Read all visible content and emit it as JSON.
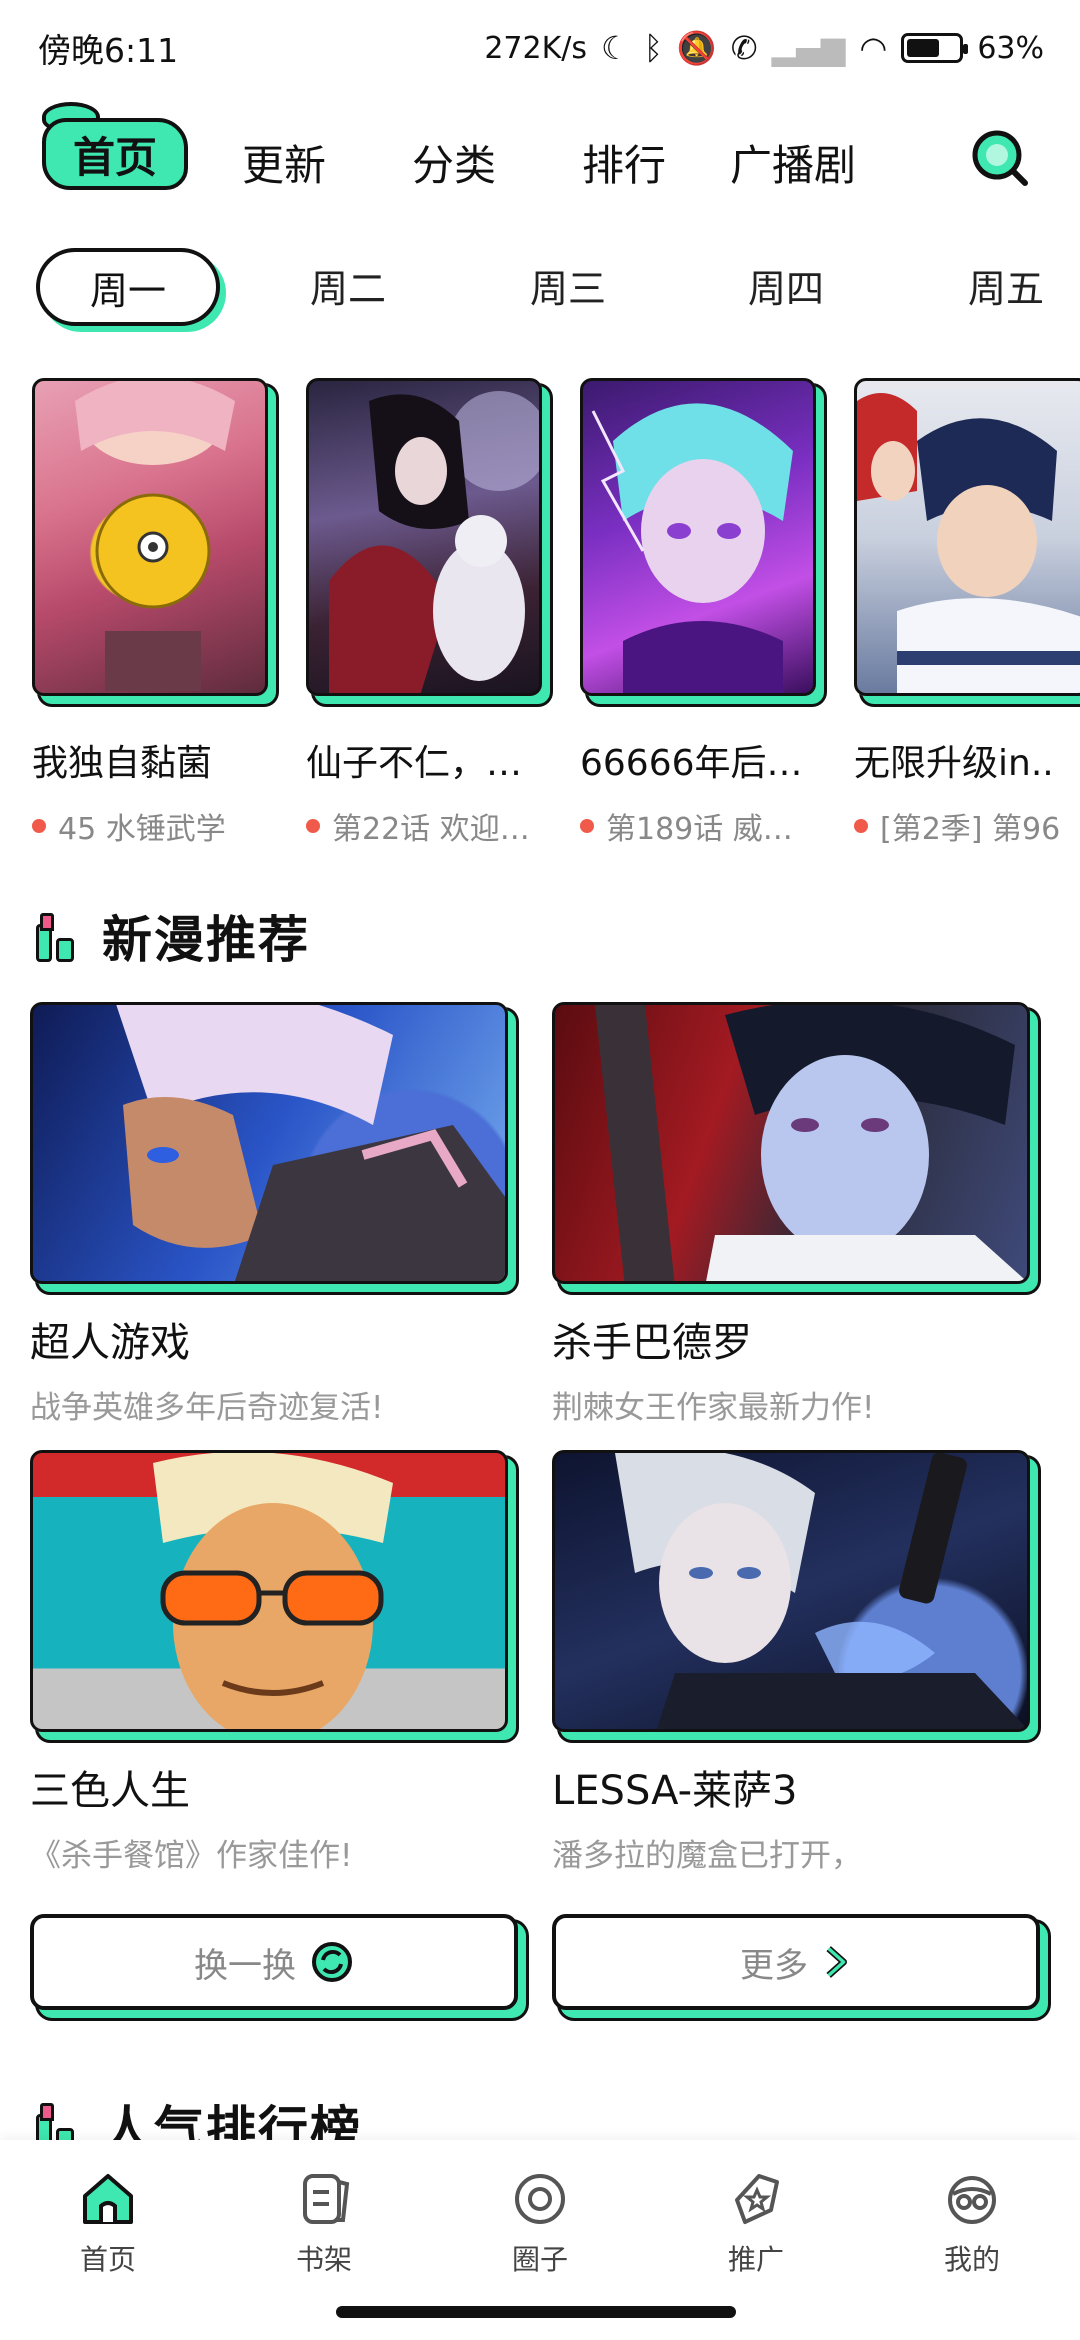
{
  "status_bar": {
    "time": "傍晚6:11",
    "net_speed": "272K/s",
    "battery": "63%",
    "battery_level": 0.63
  },
  "top_nav": {
    "items": [
      "首页",
      "更新",
      "分类",
      "排行",
      "广播剧"
    ],
    "active_index": 0,
    "search_icon": "search-icon"
  },
  "day_tabs": {
    "items": [
      "周一",
      "周二",
      "周三",
      "周四",
      "周五"
    ],
    "active_index": 0
  },
  "comics": [
    {
      "title": "我独自黏菌",
      "subtitle": "45 水锤武学"
    },
    {
      "title": "仙子不仁，…",
      "subtitle": "第22话 欢迎…"
    },
    {
      "title": "66666年后…",
      "subtitle": "第189话 威…"
    },
    {
      "title": "无限升级in..",
      "subtitle": "[第2季] 第96"
    }
  ],
  "new_section": {
    "title": "新漫推荐",
    "items": [
      {
        "title": "超人游戏",
        "subtitle": "战争英雄多年后奇迹复活!"
      },
      {
        "title": "杀手巴德罗",
        "subtitle": "荆棘女王作家最新力作!"
      },
      {
        "title": "三色人生",
        "subtitle": "《杀手餐馆》作家佳作!"
      },
      {
        "title": "LESSA-莱萨3",
        "subtitle": "潘多拉的魔盒已打开，"
      }
    ],
    "refresh_label": "换一换",
    "more_label": "更多"
  },
  "popular_section": {
    "title": "人气排行榜"
  },
  "bottom_nav": {
    "items": [
      {
        "label": "首页",
        "icon": "home-icon"
      },
      {
        "label": "书架",
        "icon": "bookshelf-icon"
      },
      {
        "label": "圈子",
        "icon": "circle-icon"
      },
      {
        "label": "推广",
        "icon": "promote-icon"
      },
      {
        "label": "我的",
        "icon": "profile-icon"
      }
    ],
    "active_index": 0
  },
  "colors": {
    "accent": "#3ee8b0",
    "dot": "#f05a4a",
    "text": "#111111",
    "muted": "#999999"
  }
}
